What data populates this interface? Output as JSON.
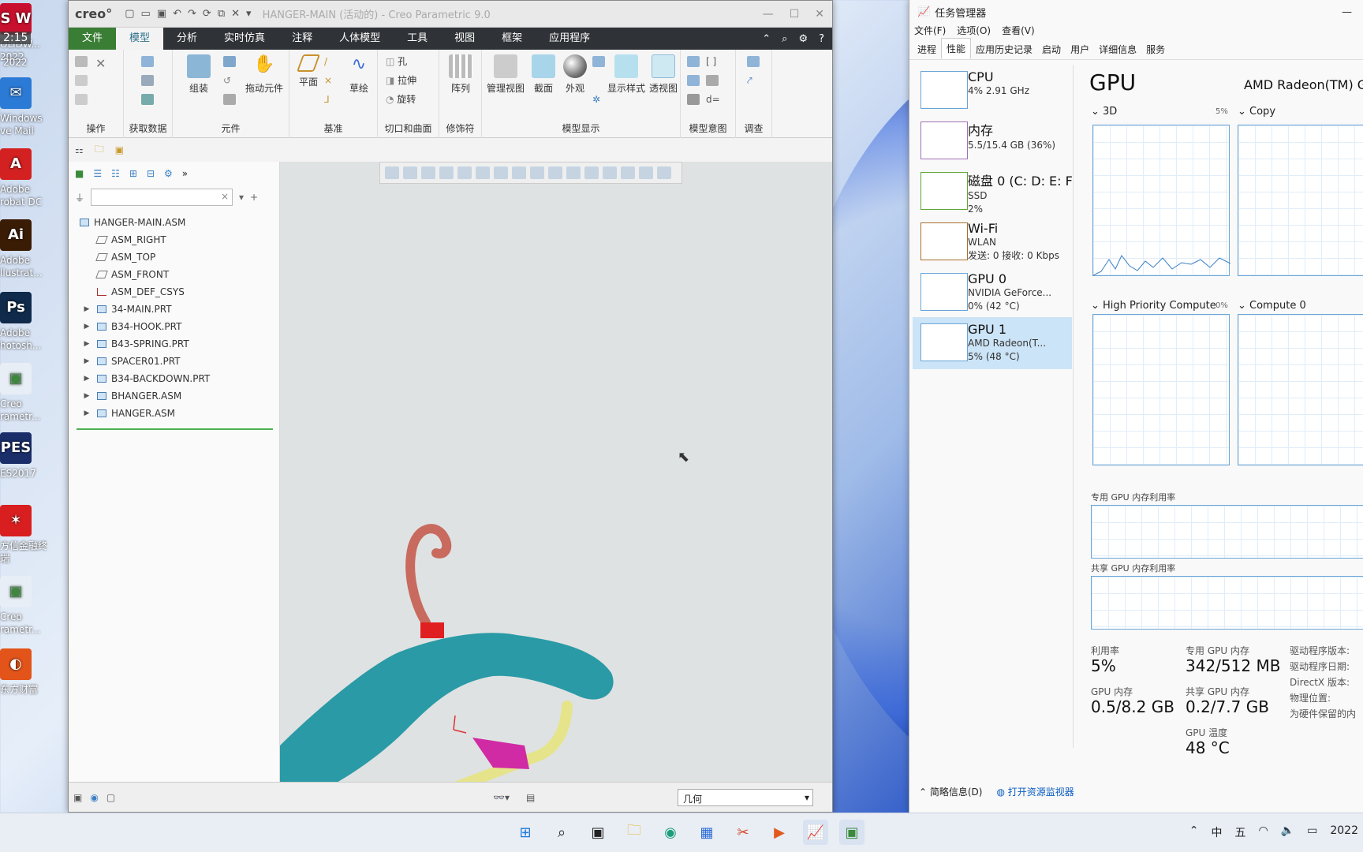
{
  "desktop": {
    "icons": [
      {
        "id": "solidworks",
        "label": "OLIDW...",
        "sub": "2022",
        "badge": "S W",
        "color": "#c8102e"
      },
      {
        "id": "mail",
        "label": "Windows",
        "sub": "ve Mail",
        "badge": "✉",
        "color": "#2a7ad6"
      },
      {
        "id": "acrobat",
        "label": "Adobe",
        "sub": "robat DC",
        "badge": "A",
        "color": "#d32020"
      },
      {
        "id": "illustrator",
        "label": "Adobe",
        "sub": "llustrat...",
        "badge": "Ai",
        "color": "#3a1c05"
      },
      {
        "id": "photoshop",
        "label": "Adobe",
        "sub": "hotosh...",
        "badge": "Ps",
        "color": "#0f2a4a"
      },
      {
        "id": "creo1",
        "label": "Creo",
        "sub": "rametr...",
        "badge": "▣",
        "color": "#e8eef5"
      },
      {
        "id": "pes",
        "label": "ES2017",
        "sub": "",
        "badge": "PES",
        "color": "#1a2f6a"
      },
      {
        "id": "finance",
        "label": "方信金融终",
        "sub": "端",
        "badge": "✶",
        "color": "#d81e1e"
      },
      {
        "id": "creo2",
        "label": "Creo",
        "sub": "rametr...",
        "badge": "▣",
        "color": "#e8eef5"
      },
      {
        "id": "eastmoney",
        "label": "东方财富",
        "sub": "",
        "badge": "◐",
        "color": "#e2541a"
      }
    ],
    "overlay_time": "2:15",
    "overlay_year": "2022"
  },
  "creo": {
    "title": "HANGER-MAIN (活动的) - Creo Parametric 9.0",
    "logo": "creo°",
    "tabs": [
      "文件",
      "模型",
      "分析",
      "实时仿真",
      "注释",
      "人体模型",
      "工具",
      "视图",
      "框架",
      "应用程序"
    ],
    "active_tab": "模型",
    "ribbon_buttons": {
      "assemble": "组装",
      "drag": "拖动元件",
      "plane": "平面",
      "sketch": "草绘",
      "hole": "孔",
      "extrude": "拉伸",
      "revolve": "旋转",
      "pattern": "阵列",
      "manage_views": "管理视图",
      "section": "截面",
      "appearance": "外观",
      "display_style": "显示样式",
      "perspective": "透视图"
    },
    "groups": [
      "操作",
      "获取数据",
      "元件",
      "基准",
      "切口和曲面",
      "修饰符",
      "模型显示",
      "模型意图",
      "调查"
    ],
    "model_tree": [
      {
        "name": "HANGER-MAIN.ASM",
        "type": "asm",
        "level": 0,
        "expand": false
      },
      {
        "name": "ASM_RIGHT",
        "type": "plane",
        "level": 1,
        "expand": false
      },
      {
        "name": "ASM_TOP",
        "type": "plane",
        "level": 1,
        "expand": false
      },
      {
        "name": "ASM_FRONT",
        "type": "plane",
        "level": 1,
        "expand": false
      },
      {
        "name": "ASM_DEF_CSYS",
        "type": "csys",
        "level": 1,
        "expand": false
      },
      {
        "name": "34-MAIN.PRT",
        "type": "prt",
        "level": 1,
        "expand": true
      },
      {
        "name": "B34-HOOK.PRT",
        "type": "prt",
        "level": 1,
        "expand": true
      },
      {
        "name": "B43-SPRING.PRT",
        "type": "prt",
        "level": 1,
        "expand": true
      },
      {
        "name": "SPACER01.PRT",
        "type": "prt",
        "level": 1,
        "expand": true
      },
      {
        "name": "B34-BACKDOWN.PRT",
        "type": "prt",
        "level": 1,
        "expand": true
      },
      {
        "name": "BHANGER.ASM",
        "type": "asm",
        "level": 1,
        "expand": true
      },
      {
        "name": "HANGER.ASM",
        "type": "asm",
        "level": 1,
        "expand": true
      }
    ],
    "status_filter": "几何",
    "colors": {
      "hook": "#c86a5e",
      "collar": "#e02020",
      "body": "#2a9aa6",
      "bar": "#e5e48a",
      "clip": "#d02ba4"
    }
  },
  "taskmgr": {
    "title": "任务管理器",
    "menu": [
      "文件(F)",
      "选项(O)",
      "查看(V)"
    ],
    "tabs": [
      "进程",
      "性能",
      "应用历史记录",
      "启动",
      "用户",
      "详细信息",
      "服务"
    ],
    "active_tab": "性能",
    "side": [
      {
        "name": "CPU",
        "l1": "4% 2.91 GHz",
        "l2": ""
      },
      {
        "name": "内存",
        "l1": "5.5/15.4 GB (36%)",
        "l2": ""
      },
      {
        "name": "磁盘 0 (C: D: E: F:",
        "l1": "SSD",
        "l2": "2%"
      },
      {
        "name": "Wi-Fi",
        "l1": "WLAN",
        "l2": "发送: 0 接收: 0 Kbps"
      },
      {
        "name": "GPU 0",
        "l1": "NVIDIA GeForce...",
        "l2": "0% (42 °C)"
      },
      {
        "name": "GPU 1",
        "l1": "AMD Radeon(T...",
        "l2": "5% (48 °C)"
      }
    ],
    "gpu_title": "GPU",
    "gpu_model": "AMD Radeon(TM) G",
    "engines": [
      {
        "name": "3D",
        "pct": "5%"
      },
      {
        "name": "Copy",
        "pct": ""
      },
      {
        "name": "High Priority Compute",
        "pct": "0%"
      },
      {
        "name": "Compute 0",
        "pct": ""
      }
    ],
    "mem_dedicated_label": "专用 GPU 内存利用率",
    "mem_shared_label": "共享 GPU 内存利用率",
    "stats": {
      "util_l": "利用率",
      "util_v": "5%",
      "ded_l": "专用 GPU 内存",
      "ded_v": "342/512 MB",
      "gmem_l": "GPU 内存",
      "gmem_v": "0.5/8.2 GB",
      "shared_l": "共享 GPU 内存",
      "shared_v": "0.2/7.7 GB",
      "temp_l": "GPU 温度",
      "temp_v": "48 °C",
      "driver_ver": "驱动程序版本:",
      "driver_date": "驱动程序日期:",
      "directx": "DirectX 版本:",
      "location": "物理位置:",
      "reserved": "为硬件保留的内"
    },
    "footer_brief": "简略信息(D)",
    "footer_monitor": "打开资源监视器"
  },
  "taskbar": {
    "tray": [
      "中",
      "五"
    ],
    "clock": "2022"
  }
}
